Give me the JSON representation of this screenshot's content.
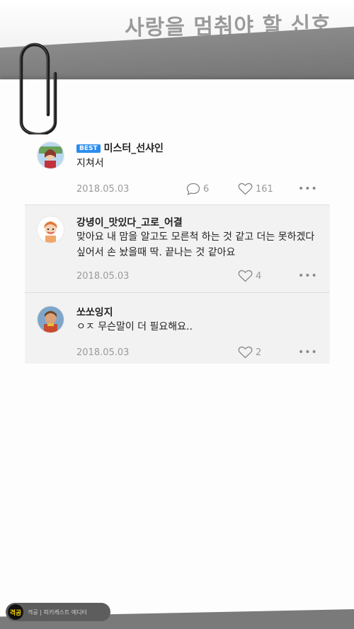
{
  "header": {
    "title": "사랑을 멈춰야 할 신호"
  },
  "comments": [
    {
      "badge": "BEST",
      "author": "미스터_선샤인",
      "text": "지쳐서",
      "date": "2018.05.03",
      "reply_count": "6",
      "like_count": "161",
      "more": "•••"
    },
    {
      "author": "강녕이_맛있다_고로_어결",
      "text": "맞아요 내 맘을 알고도 모른척 하는 것 같고 더는 못하겠다 싶어서 손 놨을때 딱. 끝나는 것 같아요",
      "date": "2018.05.03",
      "like_count": "4",
      "more": "•••"
    },
    {
      "author": "쏘쏘잉지",
      "text": "ㅇㅈ 무슨말이 더 필요해요..",
      "date": "2018.05.03",
      "like_count": "2",
      "more": "•••"
    }
  ],
  "footer": {
    "logo": "격공",
    "text": "격공 | 피키캐스트 에디터"
  },
  "colors": {
    "best_badge": "#2b8cf0",
    "reply_bg": "#f2f2f2",
    "band_gray": "#7a7a7a"
  }
}
